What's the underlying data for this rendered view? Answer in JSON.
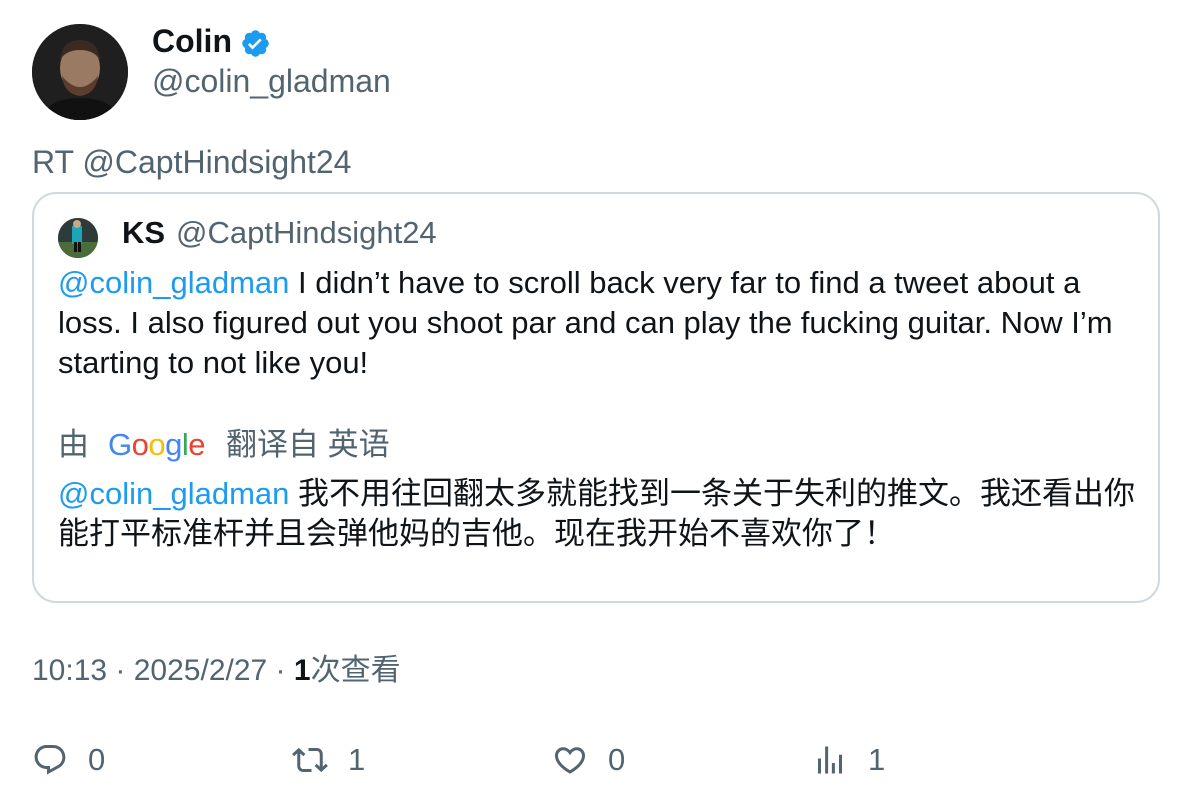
{
  "author": {
    "name": "Colin",
    "handle": "@colin_gladman",
    "avatar_icon": "profile-photo"
  },
  "retweet_line": "RT @CaptHindsight24",
  "quoted": {
    "name": "KS",
    "handle": "@CaptHindsight24",
    "mention": "@colin_gladman",
    "text": " I didn’t have to scroll back very far to find a tweet about a loss. I also figured out you shoot par and can play the fucking guitar. Now I’m starting to not like you!"
  },
  "translation": {
    "by_label": "由",
    "provider": "Google",
    "from_label": "翻译自 英语",
    "mention": "@colin_gladman",
    "text": " 我不用往回翻太多就能找到一条关于失利的推文。我还看出你能打平标准杆并且会弹他妈的吉他。现在我开始不喜欢你了！"
  },
  "meta": {
    "time": "10:13",
    "sep1": " · ",
    "date": "2025/2/27",
    "sep2": " · ",
    "views_count": "1",
    "views_label": "次查看"
  },
  "actions": {
    "replies": "0",
    "retweets": "1",
    "likes": "0",
    "views": "1"
  },
  "colors": {
    "accent": "#1d9bf0",
    "muted": "#536471",
    "text": "#0f1419",
    "border": "#cfd9de"
  }
}
